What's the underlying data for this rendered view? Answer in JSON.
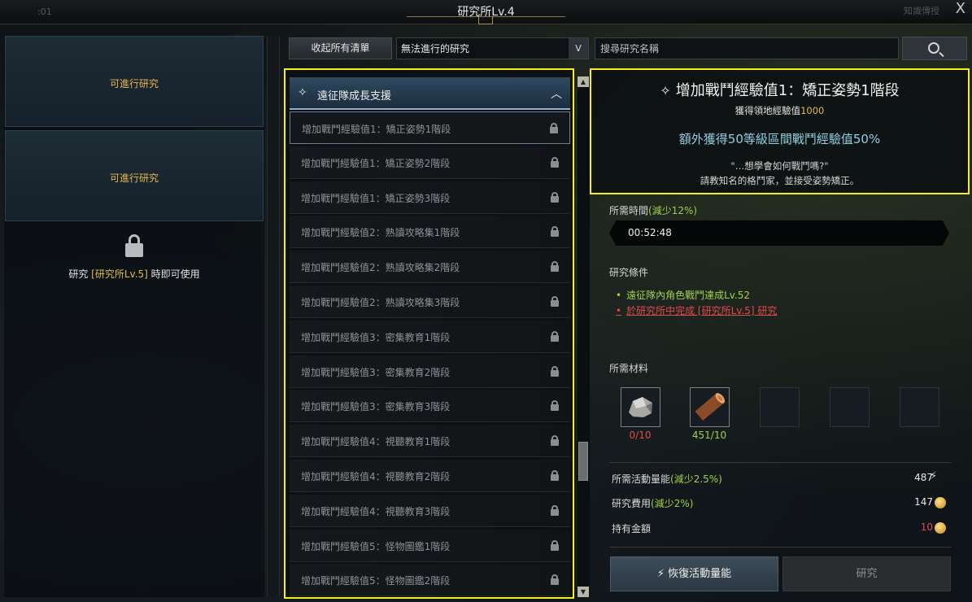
{
  "window": {
    "title": "研究所Lv.4",
    "top_left_text": ":01",
    "top_right_text": "知識傳授",
    "close_label": "X"
  },
  "left_panel": {
    "slot1_label": "可進行研究",
    "slot2_label": "可進行研究",
    "locked_prefix": "研究 ",
    "locked_highlight": "[研究所Lv.5]",
    "locked_suffix": " 時即可使用"
  },
  "toolbar": {
    "collapse_all_label": "收起所有清單",
    "filter_value": "無法進行的研究",
    "filter_arrow": "V",
    "search_placeholder": "搜尋研究名稱"
  },
  "research_list": {
    "category_label": "遠征隊成長支援",
    "category_icon": "expedition-icon",
    "items": [
      {
        "label": "增加戰鬥經驗值1：矯正姿勢1階段"
      },
      {
        "label": "增加戰鬥經驗值1：矯正姿勢2階段"
      },
      {
        "label": "增加戰鬥經驗值1：矯正姿勢3階段"
      },
      {
        "label": "增加戰鬥經驗值2：熟讀攻略集1階段"
      },
      {
        "label": "增加戰鬥經驗值2：熟讀攻略集2階段"
      },
      {
        "label": "增加戰鬥經驗值2：熟讀攻略集3階段"
      },
      {
        "label": "增加戰鬥經驗值3：密集教育1階段"
      },
      {
        "label": "增加戰鬥經驗值3：密集教育2階段"
      },
      {
        "label": "增加戰鬥經驗值3：密集教育3階段"
      },
      {
        "label": "增加戰鬥經驗值4：視聽教育1階段"
      },
      {
        "label": "增加戰鬥經驗值4：視聽教育2階段"
      },
      {
        "label": "增加戰鬥經驗值4：視聽教育3階段"
      },
      {
        "label": "增加戰鬥經驗值5：怪物圖鑑1階段"
      },
      {
        "label": "增加戰鬥經驗值5：怪物圖鑑2階段"
      }
    ]
  },
  "detail": {
    "title": "增加戰鬥經驗值1：矯正姿勢1階段",
    "xp_label": "獲得領地經驗值",
    "xp_value": "1000",
    "bonus": "額外獲得50等級區間戰鬥經驗值50%",
    "quote_line1": "\"…想學會如何戰鬥嗎?\"",
    "quote_line2": "請教知名的格鬥家，並接受姿勢矯正。"
  },
  "time": {
    "label": "所需時間",
    "reduction": "(減少12%)",
    "value": "00:52:48"
  },
  "conditions": {
    "label": "研究條件",
    "items": [
      {
        "text": "遠征隊內角色戰鬥達成Lv.52",
        "met": true
      },
      {
        "text": "於研究所中完成 [研究所Lv.5] 研究",
        "met": false
      }
    ]
  },
  "materials": {
    "label": "所需材料",
    "items": [
      {
        "icon": "ore-icon",
        "count": "0/10",
        "color": "#e34a4a"
      },
      {
        "icon": "timber-icon",
        "count": "451/10",
        "color": "#9fd04a"
      }
    ]
  },
  "costs": {
    "energy_label": "所需活動量能",
    "energy_reduction": "(減少2.5%)",
    "energy_value": "487",
    "fee_label": "研究費用",
    "fee_reduction": "(減少2%)",
    "fee_value": "147",
    "gold_label": "持有金額",
    "gold_value": "10"
  },
  "buttons": {
    "restore_label": "恢復活動量能",
    "research_label": "研究"
  }
}
